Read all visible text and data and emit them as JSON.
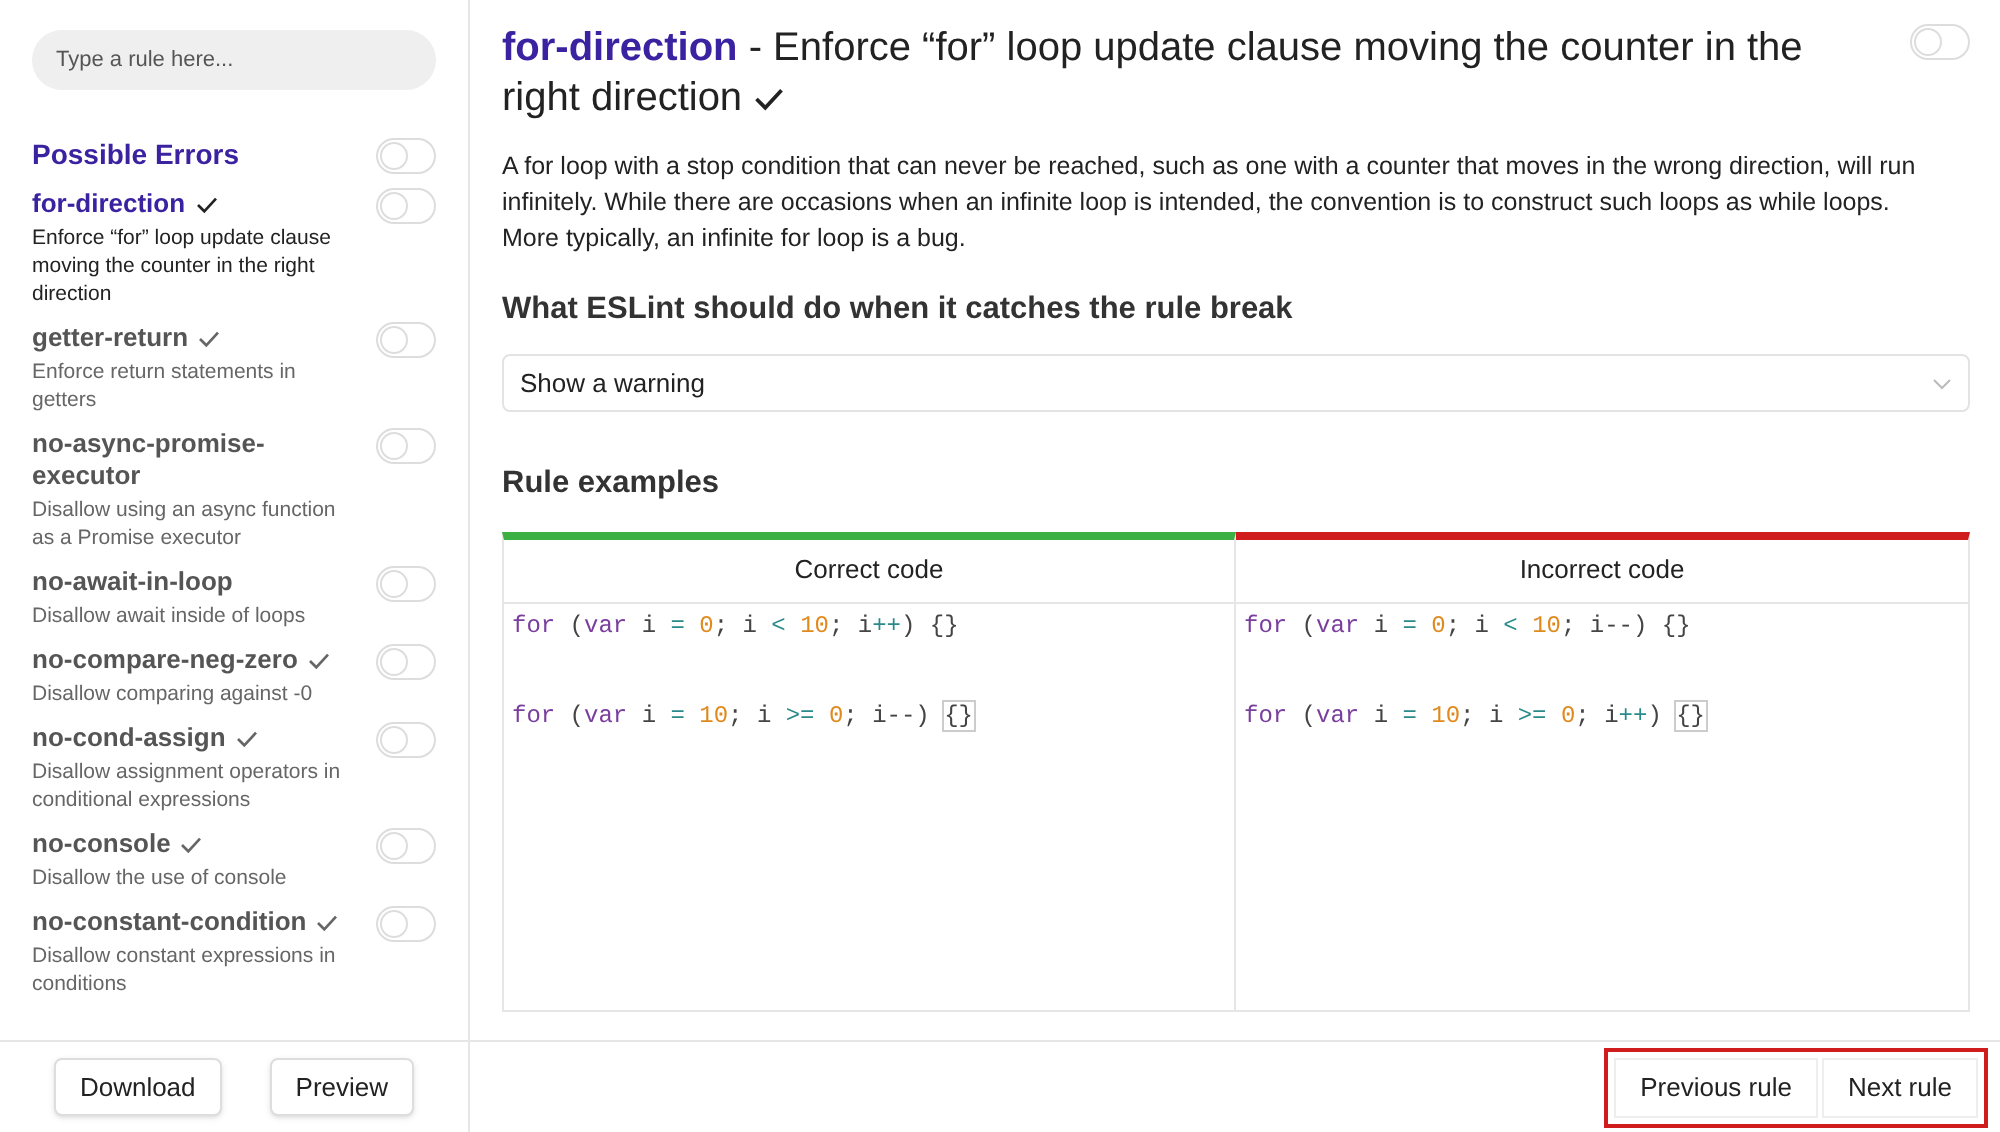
{
  "sidebar": {
    "search": {
      "placeholder": "Type a rule here..."
    },
    "category": {
      "title": "Possible Errors",
      "on": false
    },
    "rules": [
      {
        "name": "for-direction",
        "description": "Enforce “for” loop update clause moving the counter in the right direction",
        "recommended": true,
        "selected": true,
        "on": false
      },
      {
        "name": "getter-return",
        "description": "Enforce return statements in getters",
        "recommended": true,
        "selected": false,
        "on": false
      },
      {
        "name": "no-async-promise-executor",
        "description": "Disallow using an async function as a Promise executor",
        "recommended": false,
        "selected": false,
        "on": false
      },
      {
        "name": "no-await-in-loop",
        "description": "Disallow await inside of loops",
        "recommended": false,
        "selected": false,
        "on": false
      },
      {
        "name": "no-compare-neg-zero",
        "description": "Disallow comparing against -0",
        "recommended": true,
        "selected": false,
        "on": false
      },
      {
        "name": "no-cond-assign",
        "description": "Disallow assignment operators in conditional expressions",
        "recommended": true,
        "selected": false,
        "on": false
      },
      {
        "name": "no-console",
        "description": "Disallow the use of console",
        "recommended": true,
        "selected": false,
        "on": false
      },
      {
        "name": "no-constant-condition",
        "description": "Disallow constant expressions in conditions",
        "recommended": true,
        "selected": false,
        "on": false
      }
    ],
    "buttons": [
      "Download",
      "Preview"
    ]
  },
  "rule": {
    "name": "for-direction",
    "separator": "-",
    "title": "Enforce “for” loop update clause moving the counter in the right direction",
    "recommended": true,
    "on": false,
    "description": "A for loop with a stop condition that can never be reached, such as one with a counter that moves in the wrong direction, will run infinitely. While there are occasions when an infinite loop is intended, the convention is to construct such loops as while loops. More typically, an infinite for loop is a bug.",
    "severity_heading": "What ESLint should do when it catches the rule break",
    "severity": {
      "value": "Show a warning"
    },
    "examples_heading": "Rule examples",
    "examples": [
      {
        "kind": "correct",
        "heading": "Correct code",
        "lines": [
          [
            {
              "text": "for",
              "kind": "keyword"
            },
            {
              "text": " (",
              "kind": "plain"
            },
            {
              "text": "var",
              "kind": "keyword"
            },
            {
              "text": " i ",
              "kind": "plain"
            },
            {
              "text": "= ",
              "kind": "operator"
            },
            {
              "text": "0",
              "kind": "number"
            },
            {
              "text": "; i ",
              "kind": "plain"
            },
            {
              "text": "< ",
              "kind": "operator"
            },
            {
              "text": "10",
              "kind": "number"
            },
            {
              "text": "; i",
              "kind": "plain"
            },
            {
              "text": "++",
              "kind": "operator"
            },
            {
              "text": ") {}",
              "kind": "plain"
            }
          ],
          [
            {
              "text": "for",
              "kind": "keyword"
            },
            {
              "text": " (",
              "kind": "plain"
            },
            {
              "text": "var",
              "kind": "keyword"
            },
            {
              "text": " i ",
              "kind": "plain"
            },
            {
              "text": "= ",
              "kind": "operator"
            },
            {
              "text": "10",
              "kind": "number"
            },
            {
              "text": "; i ",
              "kind": "plain"
            },
            {
              "text": ">= ",
              "kind": "operator"
            },
            {
              "text": "0",
              "kind": "number"
            },
            {
              "text": "; i--) ",
              "kind": "plain"
            },
            {
              "text": "{}",
              "kind": "matched"
            }
          ]
        ]
      },
      {
        "kind": "incorrect",
        "heading": "Incorrect code",
        "lines": [
          [
            {
              "text": "for",
              "kind": "keyword"
            },
            {
              "text": " (",
              "kind": "plain"
            },
            {
              "text": "var",
              "kind": "keyword"
            },
            {
              "text": " i ",
              "kind": "plain"
            },
            {
              "text": "= ",
              "kind": "operator"
            },
            {
              "text": "0",
              "kind": "number"
            },
            {
              "text": "; i ",
              "kind": "plain"
            },
            {
              "text": "< ",
              "kind": "operator"
            },
            {
              "text": "10",
              "kind": "number"
            },
            {
              "text": "; i--) {}",
              "kind": "plain"
            }
          ],
          [
            {
              "text": "for",
              "kind": "keyword"
            },
            {
              "text": " (",
              "kind": "plain"
            },
            {
              "text": "var",
              "kind": "keyword"
            },
            {
              "text": " i ",
              "kind": "plain"
            },
            {
              "text": "= ",
              "kind": "operator"
            },
            {
              "text": "10",
              "kind": "number"
            },
            {
              "text": "; i ",
              "kind": "plain"
            },
            {
              "text": ">= ",
              "kind": "operator"
            },
            {
              "text": "0",
              "kind": "number"
            },
            {
              "text": "; i",
              "kind": "plain"
            },
            {
              "text": "++",
              "kind": "operator"
            },
            {
              "text": ") ",
              "kind": "plain"
            },
            {
              "text": "{}",
              "kind": "matched"
            }
          ]
        ]
      }
    ]
  },
  "navigation": {
    "highlighted": true,
    "buttons": [
      "Previous rule",
      "Next rule"
    ]
  }
}
